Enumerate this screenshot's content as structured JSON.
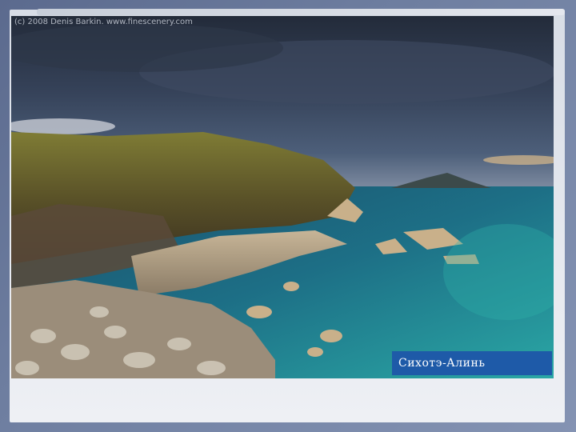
{
  "photo": {
    "credit": "(c) 2008 Denis Barkin. www.finescenery.com",
    "caption": "Сихотэ-Алинь",
    "colors": {
      "sky": "#2b3547",
      "sea": "#1d6f86",
      "shallow": "#2aa7a5",
      "hill": "#6b6a2f",
      "rock": "#b8a68c",
      "caption_bg": "#1e5aa8"
    }
  }
}
